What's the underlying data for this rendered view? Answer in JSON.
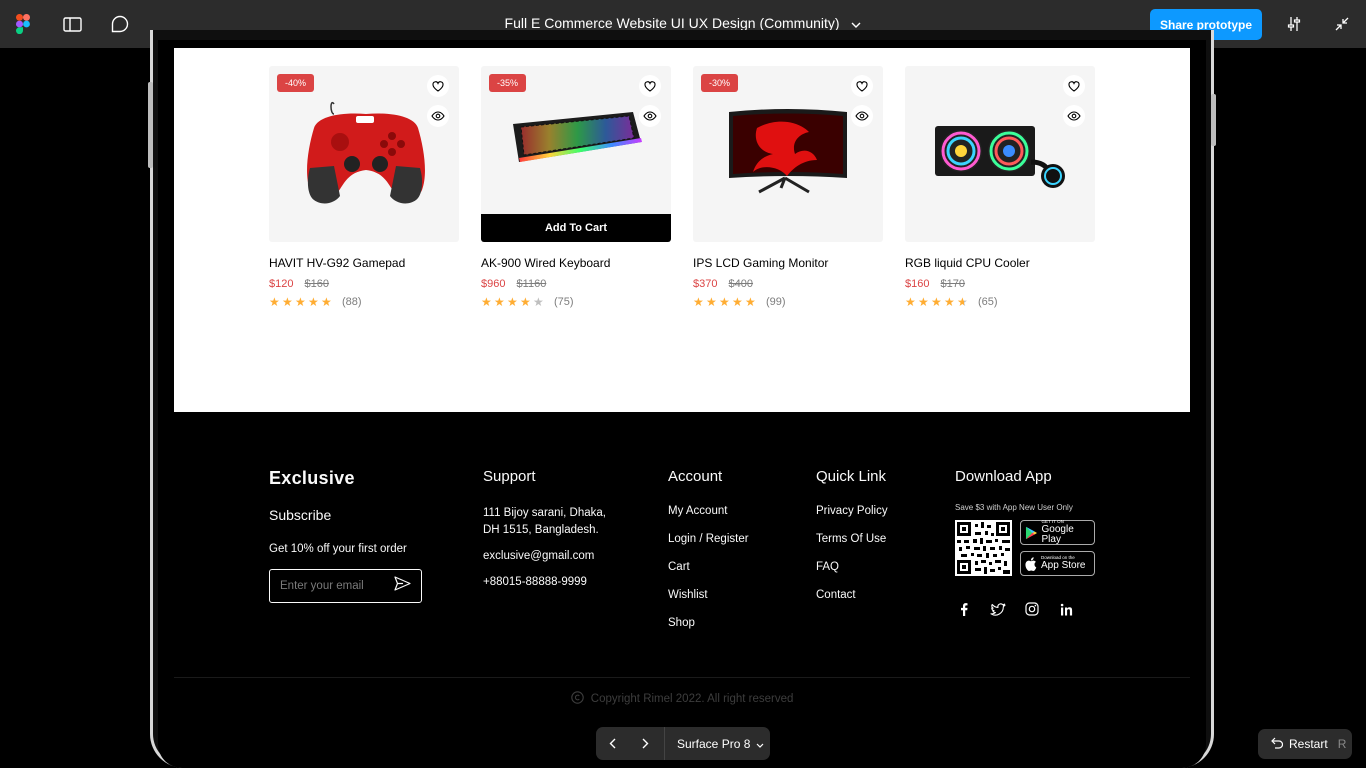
{
  "topbar": {
    "file_title": "Full E Commerce Website UI UX Design (Community)",
    "share_label": "Share prototype"
  },
  "products": [
    {
      "name": "HAVIT HV-G92 Gamepad",
      "discount": "-40%",
      "price": "$120",
      "old_price": "$160",
      "rating": 5,
      "reviews": "(88)",
      "image": "gamepad"
    },
    {
      "name": "AK-900 Wired Keyboard",
      "discount": "-35%",
      "price": "$960",
      "old_price": "$1160",
      "rating": 4,
      "reviews": "(75)",
      "image": "keyboard",
      "add_to_cart": "Add To Cart"
    },
    {
      "name": "IPS LCD Gaming Monitor",
      "discount": "-30%",
      "price": "$370",
      "old_price": "$400",
      "rating": 5,
      "reviews": "(99)",
      "image": "monitor"
    },
    {
      "name": "RGB liquid CPU Cooler",
      "price": "$160",
      "old_price": "$170",
      "rating": 4.5,
      "reviews": "(65)",
      "image": "cpu-cooler"
    }
  ],
  "footer": {
    "brand": "Exclusive",
    "subscribe": "Subscribe",
    "offer": "Get 10% off your first order",
    "email_placeholder": "Enter your email",
    "support": {
      "heading": "Support",
      "address_line1": "111 Bijoy sarani, Dhaka,",
      "address_line2": "DH 1515, Bangladesh.",
      "email": "exclusive@gmail.com",
      "phone": "+88015-88888-9999"
    },
    "account": {
      "heading": "Account",
      "links": [
        "My Account",
        "Login / Register",
        "Cart",
        "Wishlist",
        "Shop"
      ]
    },
    "quick_link": {
      "heading": "Quick Link",
      "links": [
        "Privacy Policy",
        "Terms Of Use",
        "FAQ",
        "Contact"
      ]
    },
    "download": {
      "heading": "Download App",
      "note": "Save $3 with App New User Only",
      "google_small": "GET IT ON",
      "google_big": "Google Play",
      "apple_small": "Download on the",
      "apple_big": "App Store"
    },
    "social_icons": [
      "facebook-icon",
      "twitter-icon",
      "instagram-icon",
      "linkedin-icon"
    ],
    "copyright": "Copyright Rimel 2022. All right reserved"
  },
  "bottom": {
    "device": "Surface Pro 8",
    "restart_label": "Restart",
    "restart_key": "R"
  },
  "colors": {
    "accent": "#db4444",
    "star": "#ffad33",
    "figma_blue": "#0d99ff",
    "toolbar": "#2c2c2c"
  }
}
